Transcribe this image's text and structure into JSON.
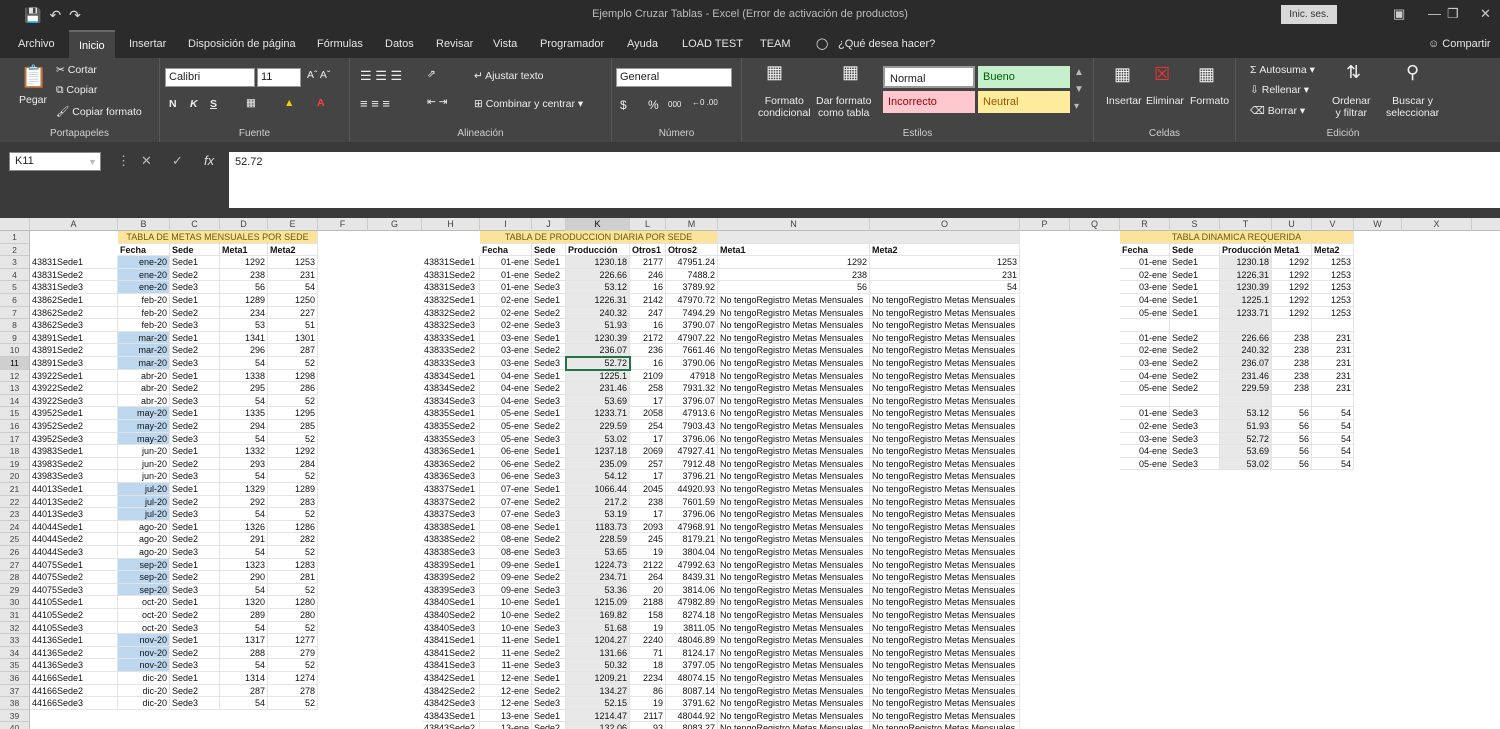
{
  "window": {
    "title": "Ejemplo Cruzar Tablas  -  Excel (Error de activación de productos)",
    "signin": "Inic. ses."
  },
  "menu": [
    "Archivo",
    "Inicio",
    "Insertar",
    "Disposición de página",
    "Fórmulas",
    "Datos",
    "Revisar",
    "Vista",
    "Programador",
    "Ayuda",
    "LOAD TEST",
    "TEAM",
    "¿Qué desea hacer?"
  ],
  "share": "Compartir",
  "ribbon": {
    "clipboard": {
      "paste": "Pegar",
      "cut": "Cortar",
      "copy": "Copiar",
      "format_painter": "Copiar formato",
      "label": "Portapapeles"
    },
    "font": {
      "name": "Calibri",
      "size": "11",
      "bold": "N",
      "italic": "K",
      "underline": "S",
      "label": "Fuente"
    },
    "alignment": {
      "wrap": "Ajustar texto",
      "merge": "Combinar y centrar",
      "label": "Alineación"
    },
    "number": {
      "format": "General",
      "currency": "$",
      "percent": "%",
      "thousands": "000",
      "label": "Número"
    },
    "styles": {
      "cond1": "Formato",
      "cond2": "condicional",
      "table1": "Dar formato",
      "table2": "como tabla",
      "normal": "Normal",
      "bueno": "Bueno",
      "incorrecto": "Incorrecto",
      "neutral": "Neutral",
      "label": "Estilos"
    },
    "cells": {
      "insert": "Insertar",
      "delete": "Eliminar",
      "format": "Formato",
      "label": "Celdas"
    },
    "editing": {
      "autosum": "Autosuma",
      "fill": "Rellenar",
      "clear": "Borrar",
      "sort1": "Ordenar",
      "sort2": "y filtrar",
      "find1": "Buscar y",
      "find2": "seleccionar",
      "label": "Edición"
    }
  },
  "formula_bar": {
    "cell": "K11",
    "value": "52.72"
  },
  "columns": [
    "A",
    "B",
    "C",
    "D",
    "E",
    "F",
    "G",
    "H",
    "I",
    "J",
    "K",
    "L",
    "M",
    "N",
    "O",
    "P",
    "Q",
    "R",
    "S",
    "T",
    "U",
    "V",
    "W",
    "X"
  ],
  "row_numbers": [
    1,
    2,
    3,
    4,
    5,
    6,
    7,
    8,
    9,
    10,
    11,
    12,
    13,
    14,
    15,
    16,
    17,
    18,
    19,
    20,
    21,
    22,
    23,
    24,
    25,
    26,
    27,
    28,
    29,
    30,
    31,
    32,
    33,
    34,
    35,
    36,
    37,
    38,
    39,
    40
  ],
  "table1": {
    "title": "TABLA DE METAS MENSUALES POR SEDE",
    "headers": [
      "Fecha",
      "Sede",
      "Meta1",
      "Meta2"
    ],
    "rows": [
      [
        "43831Sede1",
        "ene-20",
        "Sede1",
        "1292",
        "1253"
      ],
      [
        "43831Sede2",
        "ene-20",
        "Sede2",
        "238",
        "231"
      ],
      [
        "43831Sede3",
        "ene-20",
        "Sede3",
        "56",
        "54"
      ],
      [
        "43862Sede1",
        "feb-20",
        "Sede1",
        "1289",
        "1250"
      ],
      [
        "43862Sede2",
        "feb-20",
        "Sede2",
        "234",
        "227"
      ],
      [
        "43862Sede3",
        "feb-20",
        "Sede3",
        "53",
        "51"
      ],
      [
        "43891Sede1",
        "mar-20",
        "Sede1",
        "1341",
        "1301"
      ],
      [
        "43891Sede2",
        "mar-20",
        "Sede2",
        "296",
        "287"
      ],
      [
        "43891Sede3",
        "mar-20",
        "Sede3",
        "54",
        "52"
      ],
      [
        "43922Sede1",
        "abr-20",
        "Sede1",
        "1338",
        "1298"
      ],
      [
        "43922Sede2",
        "abr-20",
        "Sede2",
        "295",
        "286"
      ],
      [
        "43922Sede3",
        "abr-20",
        "Sede3",
        "54",
        "52"
      ],
      [
        "43952Sede1",
        "may-20",
        "Sede1",
        "1335",
        "1295"
      ],
      [
        "43952Sede2",
        "may-20",
        "Sede2",
        "294",
        "285"
      ],
      [
        "43952Sede3",
        "may-20",
        "Sede3",
        "54",
        "52"
      ],
      [
        "43983Sede1",
        "jun-20",
        "Sede1",
        "1332",
        "1292"
      ],
      [
        "43983Sede2",
        "jun-20",
        "Sede2",
        "293",
        "284"
      ],
      [
        "43983Sede3",
        "jun-20",
        "Sede3",
        "54",
        "52"
      ],
      [
        "44013Sede1",
        "jul-20",
        "Sede1",
        "1329",
        "1289"
      ],
      [
        "44013Sede2",
        "jul-20",
        "Sede2",
        "292",
        "283"
      ],
      [
        "44013Sede3",
        "jul-20",
        "Sede3",
        "54",
        "52"
      ],
      [
        "44044Sede1",
        "ago-20",
        "Sede1",
        "1326",
        "1286"
      ],
      [
        "44044Sede2",
        "ago-20",
        "Sede2",
        "291",
        "282"
      ],
      [
        "44044Sede3",
        "ago-20",
        "Sede3",
        "54",
        "52"
      ],
      [
        "44075Sede1",
        "sep-20",
        "Sede1",
        "1323",
        "1283"
      ],
      [
        "44075Sede2",
        "sep-20",
        "Sede2",
        "290",
        "281"
      ],
      [
        "44075Sede3",
        "sep-20",
        "Sede3",
        "54",
        "52"
      ],
      [
        "44105Sede1",
        "oct-20",
        "Sede1",
        "1320",
        "1280"
      ],
      [
        "44105Sede2",
        "oct-20",
        "Sede2",
        "289",
        "280"
      ],
      [
        "44105Sede3",
        "oct-20",
        "Sede3",
        "54",
        "52"
      ],
      [
        "44136Sede1",
        "nov-20",
        "Sede1",
        "1317",
        "1277"
      ],
      [
        "44136Sede2",
        "nov-20",
        "Sede2",
        "288",
        "279"
      ],
      [
        "44136Sede3",
        "nov-20",
        "Sede3",
        "54",
        "52"
      ],
      [
        "44166Sede1",
        "dic-20",
        "Sede1",
        "1314",
        "1274"
      ],
      [
        "44166Sede2",
        "dic-20",
        "Sede2",
        "287",
        "278"
      ],
      [
        "44166Sede3",
        "dic-20",
        "Sede3",
        "54",
        "52"
      ]
    ]
  },
  "table2": {
    "title": "TABLA DE PRODUCCION DIARIA POR SEDE",
    "headers": [
      "Fecha",
      "Sede",
      "Producción",
      "Otros1",
      "Otros2",
      "Meta1",
      "Meta2"
    ],
    "na": "No tengoRegistro Metas Mensuales",
    "rows": [
      [
        "43831Sede1",
        "01-ene",
        "Sede1",
        "1230.18",
        "2177",
        "47951.24",
        "1292",
        "1253"
      ],
      [
        "43831Sede2",
        "01-ene",
        "Sede2",
        "226.66",
        "246",
        "7488.2",
        "238",
        "231"
      ],
      [
        "43831Sede3",
        "01-ene",
        "Sede3",
        "53.12",
        "16",
        "3789.92",
        "56",
        "54"
      ],
      [
        "43832Sede1",
        "02-ene",
        "Sede1",
        "1226.31",
        "2142",
        "47970.72",
        "",
        ""
      ],
      [
        "43832Sede2",
        "02-ene",
        "Sede2",
        "240.32",
        "247",
        "7494.29",
        "",
        ""
      ],
      [
        "43832Sede3",
        "02-ene",
        "Sede3",
        "51.93",
        "16",
        "3790.07",
        "",
        ""
      ],
      [
        "43833Sede1",
        "03-ene",
        "Sede1",
        "1230.39",
        "2172",
        "47907.22",
        "",
        ""
      ],
      [
        "43833Sede2",
        "03-ene",
        "Sede2",
        "236.07",
        "236",
        "7661.46",
        "",
        ""
      ],
      [
        "43833Sede3",
        "03-ene",
        "Sede3",
        "52.72",
        "16",
        "3790.06",
        "",
        ""
      ],
      [
        "43834Sede1",
        "04-ene",
        "Sede1",
        "1225.1",
        "2109",
        "47918",
        "",
        ""
      ],
      [
        "43834Sede2",
        "04-ene",
        "Sede2",
        "231.46",
        "258",
        "7931.32",
        "",
        ""
      ],
      [
        "43834Sede3",
        "04-ene",
        "Sede3",
        "53.69",
        "17",
        "3796.07",
        "",
        ""
      ],
      [
        "43835Sede1",
        "05-ene",
        "Sede1",
        "1233.71",
        "2058",
        "47913.6",
        "",
        ""
      ],
      [
        "43835Sede2",
        "05-ene",
        "Sede2",
        "229.59",
        "254",
        "7903.43",
        "",
        ""
      ],
      [
        "43835Sede3",
        "05-ene",
        "Sede3",
        "53.02",
        "17",
        "3796.06",
        "",
        ""
      ],
      [
        "43836Sede1",
        "06-ene",
        "Sede1",
        "1237.18",
        "2069",
        "47927.41",
        "",
        ""
      ],
      [
        "43836Sede2",
        "06-ene",
        "Sede2",
        "235.09",
        "257",
        "7912.48",
        "",
        ""
      ],
      [
        "43836Sede3",
        "06-ene",
        "Sede3",
        "54.12",
        "17",
        "3796.21",
        "",
        ""
      ],
      [
        "43837Sede1",
        "07-ene",
        "Sede1",
        "1066.44",
        "2045",
        "44920.93",
        "",
        ""
      ],
      [
        "43837Sede2",
        "07-ene",
        "Sede2",
        "217.2",
        "238",
        "7601.59",
        "",
        ""
      ],
      [
        "43837Sede3",
        "07-ene",
        "Sede3",
        "53.19",
        "17",
        "3796.06",
        "",
        ""
      ],
      [
        "43838Sede1",
        "08-ene",
        "Sede1",
        "1183.73",
        "2093",
        "47968.91",
        "",
        ""
      ],
      [
        "43838Sede2",
        "08-ene",
        "Sede2",
        "228.59",
        "245",
        "8179.21",
        "",
        ""
      ],
      [
        "43838Sede3",
        "08-ene",
        "Sede3",
        "53.65",
        "19",
        "3804.04",
        "",
        ""
      ],
      [
        "43839Sede1",
        "09-ene",
        "Sede1",
        "1224.73",
        "2122",
        "47992.63",
        "",
        ""
      ],
      [
        "43839Sede2",
        "09-ene",
        "Sede2",
        "234.71",
        "264",
        "8439.31",
        "",
        ""
      ],
      [
        "43839Sede3",
        "09-ene",
        "Sede3",
        "53.36",
        "20",
        "3814.06",
        "",
        ""
      ],
      [
        "43840Sede1",
        "10-ene",
        "Sede1",
        "1215.09",
        "2188",
        "47982.89",
        "",
        ""
      ],
      [
        "43840Sede2",
        "10-ene",
        "Sede2",
        "169.82",
        "158",
        "8274.18",
        "",
        ""
      ],
      [
        "43840Sede3",
        "10-ene",
        "Sede3",
        "51.68",
        "19",
        "3811.05",
        "",
        ""
      ],
      [
        "43841Sede1",
        "11-ene",
        "Sede1",
        "1204.27",
        "2240",
        "48046.89",
        "",
        ""
      ],
      [
        "43841Sede2",
        "11-ene",
        "Sede2",
        "131.66",
        "71",
        "8124.17",
        "",
        ""
      ],
      [
        "43841Sede3",
        "11-ene",
        "Sede3",
        "50.32",
        "18",
        "3797.05",
        "",
        ""
      ],
      [
        "43842Sede1",
        "12-ene",
        "Sede1",
        "1209.21",
        "2234",
        "48074.15",
        "",
        ""
      ],
      [
        "43842Sede2",
        "12-ene",
        "Sede2",
        "134.27",
        "86",
        "8087.14",
        "",
        ""
      ],
      [
        "43842Sede3",
        "12-ene",
        "Sede3",
        "52.15",
        "19",
        "3791.62",
        "",
        ""
      ],
      [
        "43843Sede1",
        "13-ene",
        "Sede1",
        "1214.47",
        "2117",
        "48044.92",
        "",
        ""
      ],
      [
        "43843Sede2",
        "13-ene",
        "Sede2",
        "132.06",
        "93",
        "8083.27",
        "",
        ""
      ]
    ]
  },
  "table3": {
    "title": "TABLA DINAMICA REQUERIDA",
    "headers": [
      "Fecha",
      "Sede",
      "Producción",
      "Meta1",
      "Meta2"
    ],
    "rows": [
      [
        "01-ene",
        "Sede1",
        "1230.18",
        "1292",
        "1253"
      ],
      [
        "02-ene",
        "Sede1",
        "1226.31",
        "1292",
        "1253"
      ],
      [
        "03-ene",
        "Sede1",
        "1230.39",
        "1292",
        "1253"
      ],
      [
        "04-ene",
        "Sede1",
        "1225.1",
        "1292",
        "1253"
      ],
      [
        "05-ene",
        "Sede1",
        "1233.71",
        "1292",
        "1253"
      ],
      [
        "",
        "",
        "",
        "",
        ""
      ],
      [
        "01-ene",
        "Sede2",
        "226.66",
        "238",
        "231"
      ],
      [
        "02-ene",
        "Sede2",
        "240.32",
        "238",
        "231"
      ],
      [
        "03-ene",
        "Sede2",
        "236.07",
        "238",
        "231"
      ],
      [
        "04-ene",
        "Sede2",
        "231.46",
        "238",
        "231"
      ],
      [
        "05-ene",
        "Sede2",
        "229.59",
        "238",
        "231"
      ],
      [
        "",
        "",
        "",
        "",
        ""
      ],
      [
        "01-ene",
        "Sede3",
        "53.12",
        "56",
        "54"
      ],
      [
        "02-ene",
        "Sede3",
        "51.93",
        "56",
        "54"
      ],
      [
        "03-ene",
        "Sede3",
        "52.72",
        "56",
        "54"
      ],
      [
        "04-ene",
        "Sede3",
        "53.69",
        "56",
        "54"
      ],
      [
        "05-ene",
        "Sede3",
        "53.02",
        "56",
        "54"
      ]
    ]
  }
}
